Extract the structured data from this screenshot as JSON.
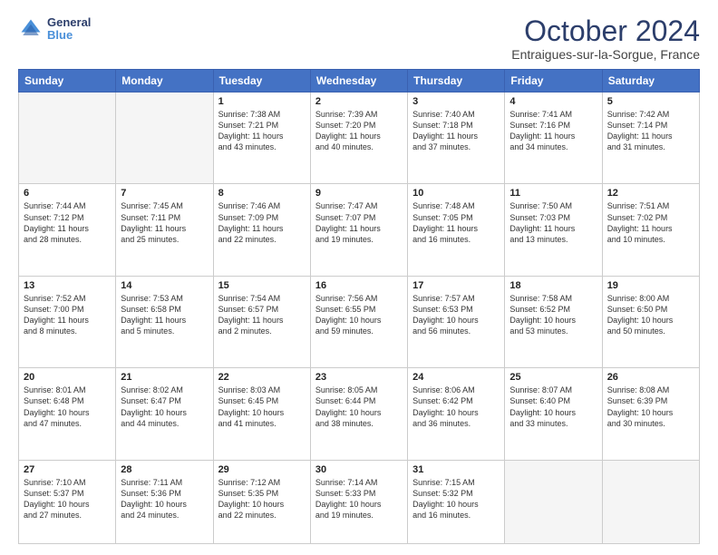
{
  "header": {
    "logo_line1": "General",
    "logo_line2": "Blue",
    "month": "October 2024",
    "location": "Entraigues-sur-la-Sorgue, France"
  },
  "weekdays": [
    "Sunday",
    "Monday",
    "Tuesday",
    "Wednesday",
    "Thursday",
    "Friday",
    "Saturday"
  ],
  "weeks": [
    [
      {
        "day": "",
        "info": ""
      },
      {
        "day": "",
        "info": ""
      },
      {
        "day": "1",
        "info": "Sunrise: 7:38 AM\nSunset: 7:21 PM\nDaylight: 11 hours\nand 43 minutes."
      },
      {
        "day": "2",
        "info": "Sunrise: 7:39 AM\nSunset: 7:20 PM\nDaylight: 11 hours\nand 40 minutes."
      },
      {
        "day": "3",
        "info": "Sunrise: 7:40 AM\nSunset: 7:18 PM\nDaylight: 11 hours\nand 37 minutes."
      },
      {
        "day": "4",
        "info": "Sunrise: 7:41 AM\nSunset: 7:16 PM\nDaylight: 11 hours\nand 34 minutes."
      },
      {
        "day": "5",
        "info": "Sunrise: 7:42 AM\nSunset: 7:14 PM\nDaylight: 11 hours\nand 31 minutes."
      }
    ],
    [
      {
        "day": "6",
        "info": "Sunrise: 7:44 AM\nSunset: 7:12 PM\nDaylight: 11 hours\nand 28 minutes."
      },
      {
        "day": "7",
        "info": "Sunrise: 7:45 AM\nSunset: 7:11 PM\nDaylight: 11 hours\nand 25 minutes."
      },
      {
        "day": "8",
        "info": "Sunrise: 7:46 AM\nSunset: 7:09 PM\nDaylight: 11 hours\nand 22 minutes."
      },
      {
        "day": "9",
        "info": "Sunrise: 7:47 AM\nSunset: 7:07 PM\nDaylight: 11 hours\nand 19 minutes."
      },
      {
        "day": "10",
        "info": "Sunrise: 7:48 AM\nSunset: 7:05 PM\nDaylight: 11 hours\nand 16 minutes."
      },
      {
        "day": "11",
        "info": "Sunrise: 7:50 AM\nSunset: 7:03 PM\nDaylight: 11 hours\nand 13 minutes."
      },
      {
        "day": "12",
        "info": "Sunrise: 7:51 AM\nSunset: 7:02 PM\nDaylight: 11 hours\nand 10 minutes."
      }
    ],
    [
      {
        "day": "13",
        "info": "Sunrise: 7:52 AM\nSunset: 7:00 PM\nDaylight: 11 hours\nand 8 minutes."
      },
      {
        "day": "14",
        "info": "Sunrise: 7:53 AM\nSunset: 6:58 PM\nDaylight: 11 hours\nand 5 minutes."
      },
      {
        "day": "15",
        "info": "Sunrise: 7:54 AM\nSunset: 6:57 PM\nDaylight: 11 hours\nand 2 minutes."
      },
      {
        "day": "16",
        "info": "Sunrise: 7:56 AM\nSunset: 6:55 PM\nDaylight: 10 hours\nand 59 minutes."
      },
      {
        "day": "17",
        "info": "Sunrise: 7:57 AM\nSunset: 6:53 PM\nDaylight: 10 hours\nand 56 minutes."
      },
      {
        "day": "18",
        "info": "Sunrise: 7:58 AM\nSunset: 6:52 PM\nDaylight: 10 hours\nand 53 minutes."
      },
      {
        "day": "19",
        "info": "Sunrise: 8:00 AM\nSunset: 6:50 PM\nDaylight: 10 hours\nand 50 minutes."
      }
    ],
    [
      {
        "day": "20",
        "info": "Sunrise: 8:01 AM\nSunset: 6:48 PM\nDaylight: 10 hours\nand 47 minutes."
      },
      {
        "day": "21",
        "info": "Sunrise: 8:02 AM\nSunset: 6:47 PM\nDaylight: 10 hours\nand 44 minutes."
      },
      {
        "day": "22",
        "info": "Sunrise: 8:03 AM\nSunset: 6:45 PM\nDaylight: 10 hours\nand 41 minutes."
      },
      {
        "day": "23",
        "info": "Sunrise: 8:05 AM\nSunset: 6:44 PM\nDaylight: 10 hours\nand 38 minutes."
      },
      {
        "day": "24",
        "info": "Sunrise: 8:06 AM\nSunset: 6:42 PM\nDaylight: 10 hours\nand 36 minutes."
      },
      {
        "day": "25",
        "info": "Sunrise: 8:07 AM\nSunset: 6:40 PM\nDaylight: 10 hours\nand 33 minutes."
      },
      {
        "day": "26",
        "info": "Sunrise: 8:08 AM\nSunset: 6:39 PM\nDaylight: 10 hours\nand 30 minutes."
      }
    ],
    [
      {
        "day": "27",
        "info": "Sunrise: 7:10 AM\nSunset: 5:37 PM\nDaylight: 10 hours\nand 27 minutes."
      },
      {
        "day": "28",
        "info": "Sunrise: 7:11 AM\nSunset: 5:36 PM\nDaylight: 10 hours\nand 24 minutes."
      },
      {
        "day": "29",
        "info": "Sunrise: 7:12 AM\nSunset: 5:35 PM\nDaylight: 10 hours\nand 22 minutes."
      },
      {
        "day": "30",
        "info": "Sunrise: 7:14 AM\nSunset: 5:33 PM\nDaylight: 10 hours\nand 19 minutes."
      },
      {
        "day": "31",
        "info": "Sunrise: 7:15 AM\nSunset: 5:32 PM\nDaylight: 10 hours\nand 16 minutes."
      },
      {
        "day": "",
        "info": ""
      },
      {
        "day": "",
        "info": ""
      }
    ]
  ]
}
